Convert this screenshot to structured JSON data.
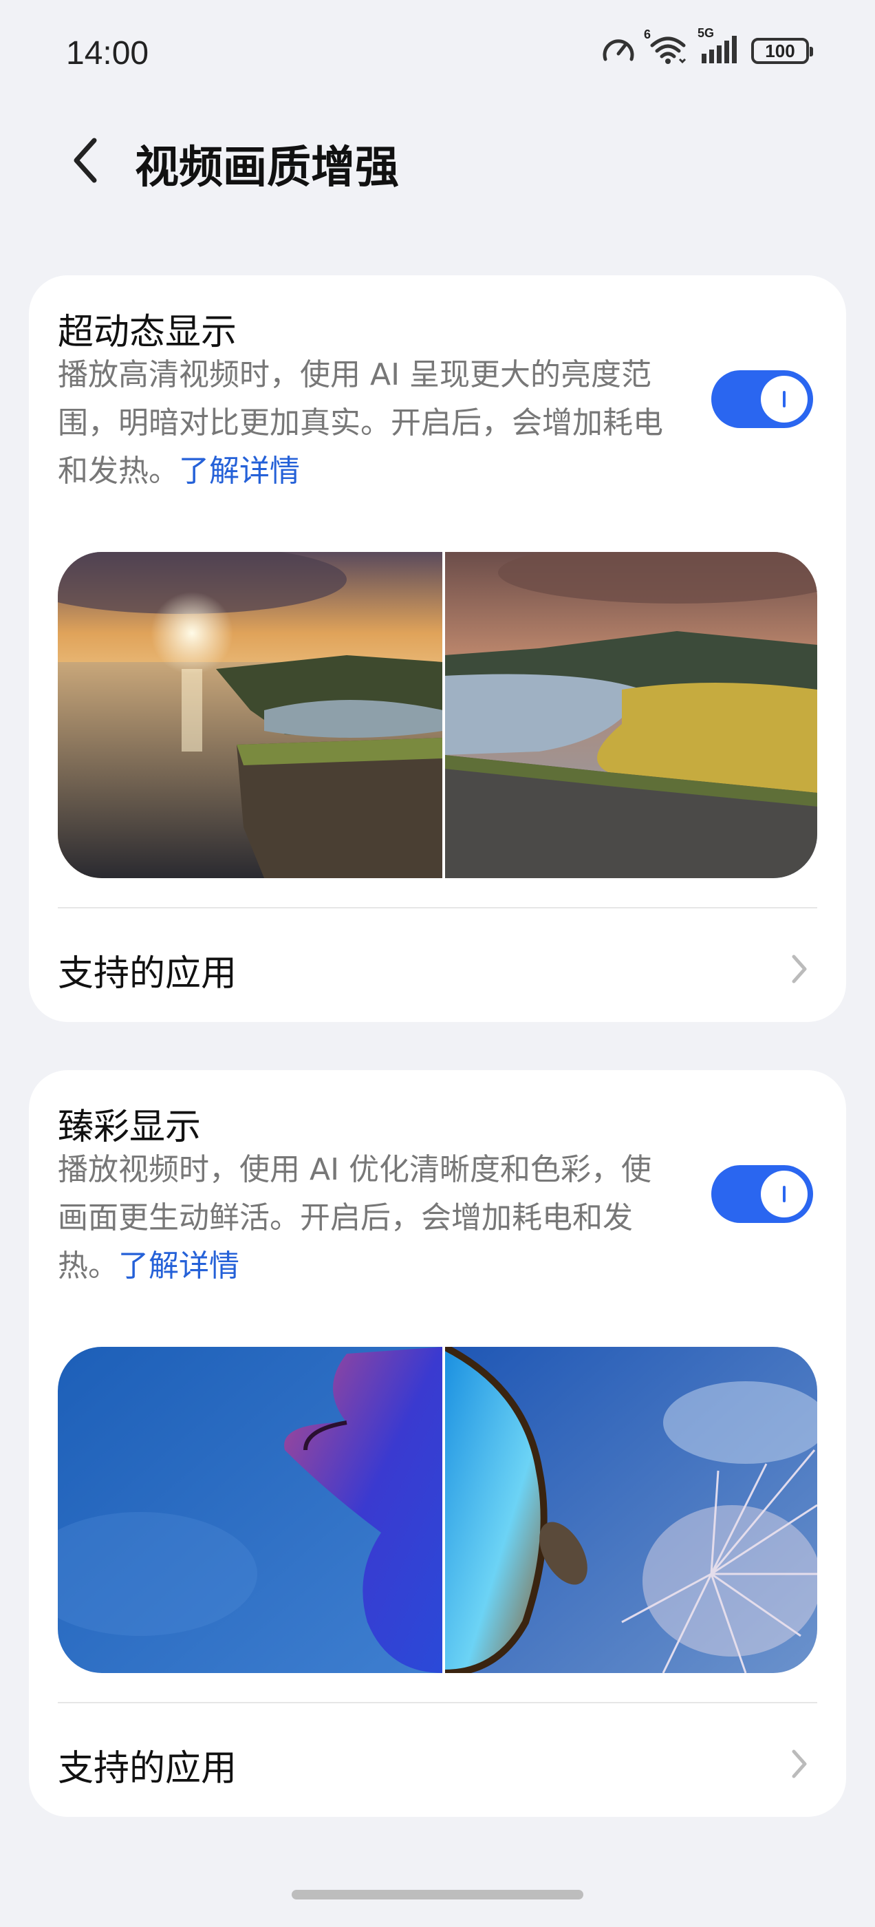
{
  "status_bar": {
    "time": "14:00",
    "wifi_label": "6",
    "network_label": "5G",
    "battery": "100",
    "icons": [
      "speed-meter-icon",
      "wifi-icon",
      "cellular-signal-icon",
      "battery-icon"
    ]
  },
  "header": {
    "title": "视频画质增强",
    "back_icon": "back-arrow-icon"
  },
  "cards": [
    {
      "title": "超动态显示",
      "description": "播放高清视频时，使用 AI 呈现更大的亮度范围，明暗对比更加真实。开启后，会增加耗电和发热。",
      "learn_more": "了解详情",
      "toggle_on": true,
      "preview": "landscape-comparison",
      "support_label": "支持的应用"
    },
    {
      "title": "臻彩显示",
      "description": "播放视频时，使用 AI 优化清晰度和色彩，使画面更生动鲜活。开启后，会增加耗电和发热。",
      "learn_more": "了解详情",
      "toggle_on": true,
      "preview": "butterfly-comparison",
      "support_label": "支持的应用"
    }
  ],
  "colors": {
    "background": "#f1f2f6",
    "card": "#ffffff",
    "accent": "#2a66f0",
    "link": "#2561d8",
    "secondary_text": "#777777"
  }
}
